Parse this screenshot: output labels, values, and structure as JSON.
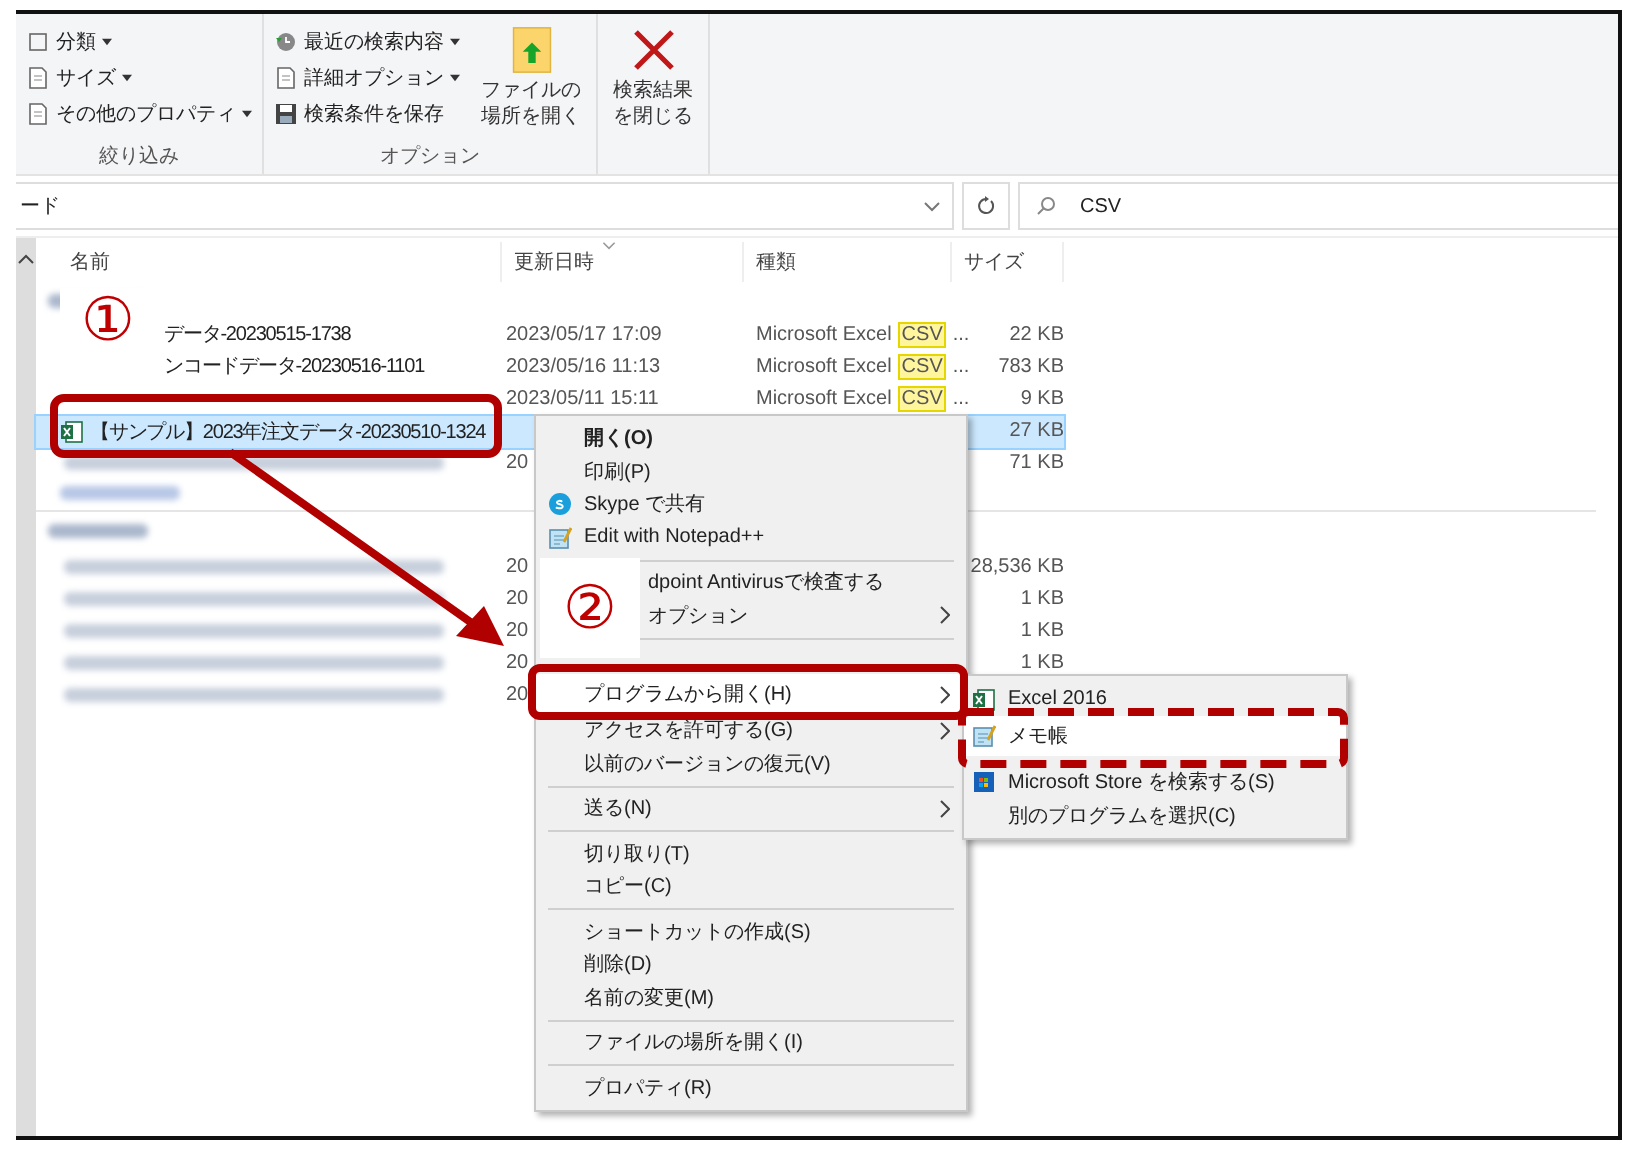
{
  "ribbon": {
    "groups": [
      {
        "label": "絞り込み",
        "items": [
          {
            "label": "分類",
            "has_menu": true
          },
          {
            "label": "サイズ",
            "has_menu": true
          },
          {
            "label": "その他のプロパティ",
            "has_menu": true
          }
        ]
      },
      {
        "label": "オプション",
        "items": [
          {
            "label": "最近の検索内容",
            "has_menu": true
          },
          {
            "label": "詳細オプション",
            "has_menu": true
          },
          {
            "label": "検索条件を保存",
            "has_menu": false
          }
        ],
        "big_buttons": [
          {
            "label": "ファイルの場所を開く"
          }
        ]
      },
      {
        "big_buttons": [
          {
            "label": "検索結果を閉じる"
          }
        ]
      }
    ]
  },
  "address_bar": {
    "path": "ード"
  },
  "search": {
    "value": "CSV"
  },
  "columns": [
    {
      "label": "名前",
      "sorted": false
    },
    {
      "label": "更新日時",
      "sorted": true
    },
    {
      "label": "種類",
      "sorted": false
    },
    {
      "label": "サイズ",
      "sorted": false
    }
  ],
  "groups": [
    {
      "rows": [
        {
          "name": "データ-20230515-1738",
          "name_blurred": false,
          "date": "2023/05/17 17:09",
          "type": "Microsoft Excel",
          "match": "CSV",
          "type_tail": "...",
          "size": "22 KB",
          "selected": false
        },
        {
          "name": "ンコードデータ-20230516-1101",
          "name_blurred": false,
          "date": "2023/05/16 11:13",
          "type": "Microsoft Excel",
          "match": "CSV",
          "type_tail": "...",
          "size": "783 KB",
          "selected": false
        },
        {
          "name_blurred": false,
          "date": "2023/05/11 15:11",
          "type": "Microsoft Excel",
          "match": "CSV",
          "type_tail": "...",
          "size": "9 KB",
          "selected": false
        },
        {
          "name": "【サンプル】2023年注文データ-20230510-1324",
          "name_blurred": false,
          "size": "27 KB",
          "selected": true
        },
        {
          "name_blurred": true,
          "date": "20",
          "size": "71 KB",
          "selected": false
        }
      ]
    },
    {
      "rows": [
        {
          "name_blurred": true,
          "date": "20",
          "size": "28,536 KB",
          "selected": false
        },
        {
          "name_blurred": true,
          "date": "20",
          "size": "1 KB",
          "selected": false
        },
        {
          "name_blurred": true,
          "date": "20",
          "size": "1 KB",
          "selected": false
        },
        {
          "name_blurred": true,
          "date": "20",
          "size": "1 KB",
          "selected": false
        },
        {
          "name_blurred": true,
          "date": "20",
          "selected": false
        }
      ]
    }
  ],
  "context_menu": {
    "items": [
      {
        "kind": "plain",
        "label": "開く(O)",
        "bold": true,
        "submenu": false,
        "selected": false
      },
      {
        "kind": "plain",
        "label": "印刷(P)",
        "bold": false,
        "submenu": false,
        "selected": false
      },
      {
        "kind": "skype",
        "label": "Skype で共有",
        "bold": false,
        "submenu": false,
        "selected": false
      },
      {
        "kind": "notepad",
        "label": "Edit with Notepad++",
        "bold": false,
        "submenu": false,
        "selected": false
      },
      {
        "kind": "separator"
      },
      {
        "kind": "cut",
        "label": "dpoint Antivirusで検査する",
        "bold": false,
        "submenu": false,
        "selected": false
      },
      {
        "kind": "cut",
        "label": "オプション",
        "bold": false,
        "submenu": true,
        "selected": false
      },
      {
        "kind": "separator"
      },
      {
        "kind": "blank"
      },
      {
        "kind": "plain",
        "label": "プログラムから開く(H)",
        "bold": false,
        "submenu": true,
        "selected": true
      },
      {
        "kind": "plain",
        "label": "アクセスを許可する(G)",
        "bold": false,
        "submenu": true,
        "selected": false
      },
      {
        "kind": "plain",
        "label": "以前のバージョンの復元(V)",
        "bold": false,
        "submenu": false,
        "selected": false
      },
      {
        "kind": "separator"
      },
      {
        "kind": "plain",
        "label": "送る(N)",
        "bold": false,
        "submenu": true,
        "selected": false
      },
      {
        "kind": "separator"
      },
      {
        "kind": "plain",
        "label": "切り取り(T)",
        "bold": false,
        "submenu": false,
        "selected": false
      },
      {
        "kind": "plain",
        "label": "コピー(C)",
        "bold": false,
        "submenu": false,
        "selected": false
      },
      {
        "kind": "separator"
      },
      {
        "kind": "plain",
        "label": "ショートカットの作成(S)",
        "bold": false,
        "submenu": false,
        "selected": false
      },
      {
        "kind": "plain",
        "label": "削除(D)",
        "bold": false,
        "submenu": false,
        "selected": false
      },
      {
        "kind": "plain",
        "label": "名前の変更(M)",
        "bold": false,
        "submenu": false,
        "selected": false
      },
      {
        "kind": "separator"
      },
      {
        "kind": "plain",
        "label": "ファイルの場所を開く(I)",
        "bold": false,
        "submenu": false,
        "selected": false
      },
      {
        "kind": "separator"
      },
      {
        "kind": "plain",
        "label": "プロパティ(R)",
        "bold": false,
        "submenu": false,
        "selected": false
      }
    ]
  },
  "submenu": {
    "items": [
      {
        "kind": "excel",
        "label": "Excel 2016",
        "selected": false
      },
      {
        "kind": "notepad",
        "label": "メモ帳",
        "selected": true
      },
      {
        "kind": "separator"
      },
      {
        "kind": "store",
        "label": "Microsoft Store を検索する(S)",
        "selected": false
      },
      {
        "kind": "plain",
        "label": "別のプログラムを選択(C)",
        "selected": false
      }
    ]
  },
  "annotations": {
    "step_1": "①",
    "step_2": "②"
  }
}
